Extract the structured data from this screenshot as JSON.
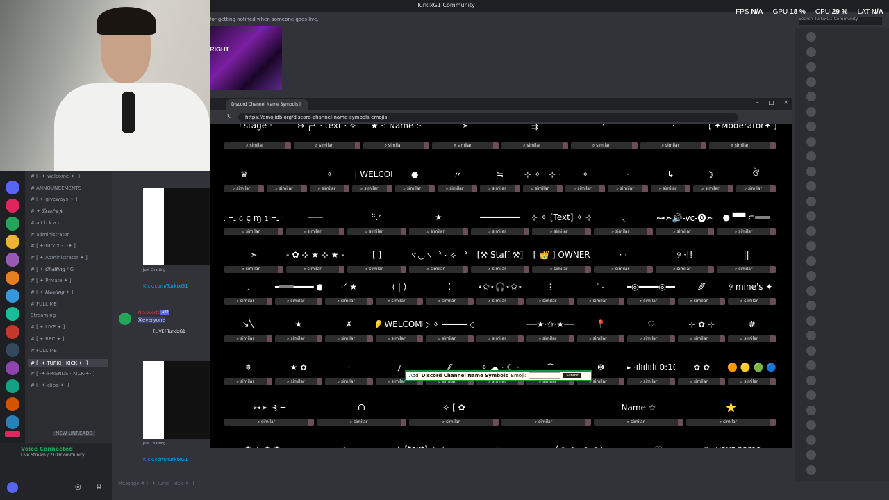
{
  "window": {
    "title": "TurkixG1 Community"
  },
  "hud": {
    "fps_label": "FPS",
    "fps_value": "N/A",
    "gpu_label": "GPU",
    "gpu_value": "18 %",
    "cpu_label": "CPU",
    "cpu_value": "29 %",
    "lat_label": "LAT",
    "lat_value": "N/A"
  },
  "search_placeholder": "Search TurkixG1 Community",
  "notice": "for getting notified when someone goes live.",
  "art_text": "RIGHT",
  "channels": [
    {
      "label": "[ -✦-welcome-✦- ]",
      "icon": "#"
    },
    {
      "label": "ANNOUNCEMENTS",
      "icon": "#"
    },
    {
      "label": "[ ✦-giveways-✦ ]",
      "icon": "#"
    },
    {
      "label": "✦ 𝓛𝓮𝓿𝓮𝓵-𝓾𝓹",
      "icon": "#"
    },
    {
      "label": "a t h k a r",
      "icon": "#"
    },
    {
      "label": "administrator",
      "icon": "#"
    },
    {
      "label": "[ ✦-turkixG1-✦ ]",
      "icon": "#"
    },
    {
      "label": "[ ✦ Administrator ✦ ]",
      "icon": "#"
    },
    {
      "label": "[ ✦ 𝑪𝒉𝒂𝒕𝒕𝒊𝒏𝒈 / G",
      "icon": "#"
    },
    {
      "label": "[ ✦ Private ✦ ]",
      "icon": "#"
    },
    {
      "label": "[ ✦ 𝑴𝒆𝒆𝒕𝒊𝒏𝒈 ✦ ]",
      "icon": "#"
    },
    {
      "label": "FULL ME",
      "icon": "#"
    },
    {
      "label": "Streaming",
      "icon": ""
    },
    {
      "label": "[ ✦ LIVE ✦ ]",
      "icon": "#"
    },
    {
      "label": "[ ✦ REC ✦ ]",
      "icon": "#"
    },
    {
      "label": "FULL ME",
      "icon": "#"
    },
    {
      "label": "[ -✦-TURKI · KICK-✦- ]",
      "icon": "#"
    },
    {
      "label": "[ -✦-FRIENDS · KICK-✦- ]",
      "icon": "#"
    },
    {
      "label": "[ -✦-clips-✦- ]",
      "icon": "#"
    }
  ],
  "new_unreads": "NEW UNREADS",
  "voice": {
    "status": "Voice Connected",
    "sub": "Live Stream / 2101Community"
  },
  "chat": {
    "caption1": "Just Chatting",
    "link1": "Kick.com/TurkixG1",
    "alert_name": "Kick Alerts",
    "alert_badge": "APP",
    "alert_mention": "@everyone",
    "alert_live": "[LIVE] TurkixG1",
    "caption2": "Just Chatting",
    "link2": "Kick.com/TurkixG1"
  },
  "message_placeholder": "Message # [ -✦-turki · kick-✦- ]",
  "browser": {
    "tab_title": "Discord Channel Name Symbols |",
    "url": "https://emojidb.org/discord-channel-name-symbols-emojis",
    "similar": "similar"
  },
  "rows": [
    [
      "ᵎ stage ˀˀ",
      "↣ ┌┘ · text · ✧",
      "★ ·: Name :·",
      "➣",
      "⇶",
      "ᐟ",
      "ᐧ",
      "[ ✦Moderator✦ ]"
    ],
    [
      "♛",
      "",
      "✧",
      "👋 | WELCOME",
      "●",
      "〃",
      "≒",
      "⊹ ✧ · ⊹ ·",
      "✧",
      "·",
      "↳",
      "》",
      "ঔ"
    ],
    [
      "ᯓ ᯓ ᯓ ૮ ç ɱ ɿ ᯓ ᯓ ᯓ",
      "───",
      "ᵕ̈.ᐟ",
      "★",
      "━━━━━━━━",
      "⊹ ✧ [Text] ✧ ⊹",
      "⸜",
      "⊶➣🔊-vc-⓿➣",
      "● ▀▀ ⊂═══"
    ],
    [
      "➣",
      "⊹ ✿ ⊹ ★ ⊹ ★ ⊹",
      "[ ]",
      "〝ヾ◡ヽ〝 · ✧ 〝ヽ",
      "[⚒ Staff ⚒]",
      "[ 👑 ] OWNER",
      "· ·",
      "୨ ·!!",
      "||"
    ],
    [
      "⸝",
      "━═══━━━━ ●",
      "·ᐟ ★",
      "⟨ | ⟩",
      "⁚",
      "⋆✩⋆🎧⋆✩⋆",
      "⋮",
      "ﾟ·",
      "✦━◎━━━━◎━━✦",
      "⁄⁄⁄",
      "·୨ mine's ✦ ·"
    ],
    [
      "↘╲",
      "★",
      "✗",
      "💛 WELCOME",
      "◇ ✧ ━━━━━ ◇",
      "",
      "──★·✩·★──",
      "📍",
      "♡",
      "⊹ ✿ ⊹",
      "#"
    ],
    [
      "✵",
      "★ ✿",
      "·",
      "ﾉ",
      "⁄⁄",
      "✧ ☁ · ☾ ·",
      "⌒",
      "❆",
      "▶ ·ılıılıılı 0:10",
      "✿ ✿",
      "🔴 🟠 🟡 🟢 🔵 🟣"
    ],
    [
      "⊶➣ ⊰ ━",
      "ᗝ",
      "✧ [ ✿",
      "",
      "Name ☆",
      "⭐"
    ],
    [
      "✿ ✦ ✿ ✿",
      "· ✧",
      "⊹ [text] ✧ ⊹",
      "➣",
      "(  ≥ > ≤ ≤  )",
      "♡",
      "⌑ · your name ..."
    ]
  ],
  "popup": {
    "label_pre": "Add",
    "label_bold": "Discord Channel Name Symbols",
    "label_post": "Emoji:",
    "submit": "Submit"
  },
  "colors": {
    "discord_bg": "#313338",
    "sidebar": "#2b2d31",
    "accent_green": "#23a55a",
    "link": "#00a8fc"
  }
}
